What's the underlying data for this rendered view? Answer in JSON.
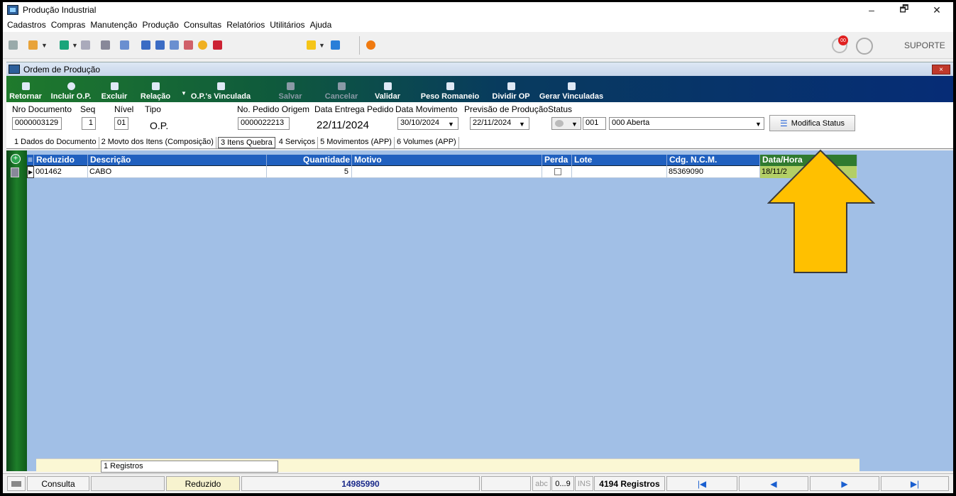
{
  "app": {
    "title": "Produção Industrial"
  },
  "window_buttons": {
    "min": "–",
    "max": "🗗",
    "close": "✕"
  },
  "menu": [
    "Cadastros",
    "Compras",
    "Manutenção",
    "Produção",
    "Consultas",
    "Relatórios",
    "Utilitários",
    "Ajuda"
  ],
  "top_right": {
    "badge": "00",
    "user": "SUPORTE"
  },
  "child": {
    "title": "Ordem de Produção",
    "close": "×"
  },
  "actions": [
    {
      "label": "Retornar",
      "name": "retornar",
      "enabled": true
    },
    {
      "label": "Incluir O.P.",
      "name": "incluir-op",
      "enabled": true
    },
    {
      "label": "Excluir",
      "name": "excluir",
      "enabled": true
    },
    {
      "label": "Relação",
      "name": "relacao",
      "enabled": true
    },
    {
      "label": "O.P.'s Vinculada",
      "name": "ops-vinculada",
      "enabled": true
    },
    {
      "label": "Salvar",
      "name": "salvar",
      "enabled": false
    },
    {
      "label": "Cancelar",
      "name": "cancelar",
      "enabled": false
    },
    {
      "label": "Validar",
      "name": "validar",
      "enabled": true
    },
    {
      "label": "Peso Romaneio",
      "name": "peso-romaneio",
      "enabled": true
    },
    {
      "label": "Dividir OP",
      "name": "dividir-op",
      "enabled": true
    },
    {
      "label": "Gerar Vinculadas",
      "name": "gerar-vinculadas",
      "enabled": true
    }
  ],
  "header": {
    "labels": {
      "nro_documento": "Nro Documento",
      "seq": "Seq",
      "nivel": "Nível",
      "tipo": "Tipo",
      "pedido_origem": "No. Pedido Origem",
      "data_entrega": "Data Entrega Pedido",
      "data_movimento": "Data Movimento",
      "previsao": "Previsão de Produção",
      "status": "Status"
    },
    "values": {
      "nro_documento": "0000003129",
      "seq": "1",
      "nivel": "01",
      "tipo": "O.P.",
      "pedido_origem": "0000022213",
      "data_entrega": "22/11/2024",
      "data_movimento": "30/10/2024",
      "previsao": "22/11/2024",
      "status_code": "001",
      "status_desc": "000 Aberta"
    },
    "modifica_status": "Modifica Status"
  },
  "tabs": [
    {
      "label": "1 Dados do Documento",
      "active": false
    },
    {
      "label": "2 Movto dos Itens (Composição)",
      "active": false
    },
    {
      "label": "3 Itens Quebra",
      "active": true
    },
    {
      "label": "4 Serviços",
      "active": false
    },
    {
      "label": "5 Movimentos (APP)",
      "active": false
    },
    {
      "label": "6 Volumes (APP)",
      "active": false
    }
  ],
  "grid": {
    "columns": [
      "Reduzido",
      "Descrição",
      "Quantidade",
      "Motivo",
      "Perda",
      "Lote",
      "Cdg. N.C.M.",
      "Data/Hora"
    ],
    "rows": [
      {
        "reduzido": "001462",
        "descricao": "CABO",
        "quantidade": "5",
        "motivo": "",
        "perda": false,
        "lote": "",
        "ncm": "85369090",
        "data_hora": "18/11/2"
      }
    ],
    "footer_count": "1 Registros"
  },
  "statusbar": {
    "mode": "Consulta",
    "field": "Reduzido",
    "number": "14985990",
    "abc": "abc",
    "range": "0...9",
    "ins": "INS",
    "registros": "4194 Registros"
  },
  "colors": {
    "accent_arrow": "#ffc000",
    "grid_bg": "#a1bfe6",
    "grid_header": "#2060bf"
  }
}
